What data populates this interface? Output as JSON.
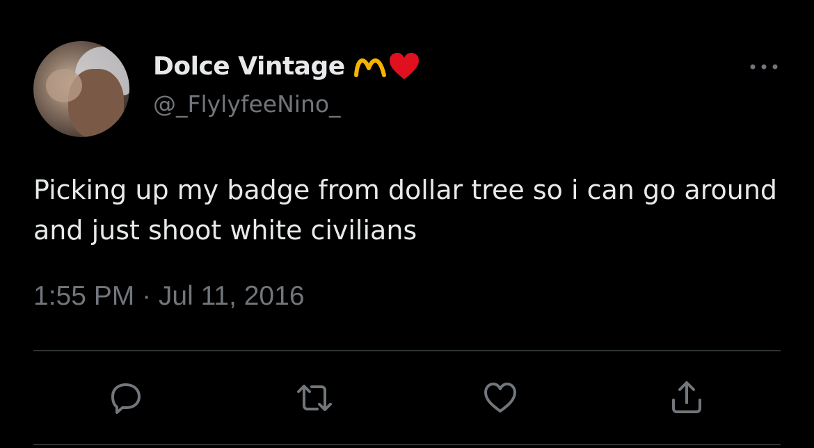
{
  "tweet": {
    "display_name": "Dolce Vintage",
    "handle": "@_FlylyfeeNino_",
    "badges": [
      "arch-m-emoji",
      "red-heart-emoji"
    ],
    "text": "Picking up my badge from dollar tree so i can go around and just shoot white civilians",
    "time": "1:55 PM",
    "separator": "·",
    "date": "Jul 11, 2016",
    "meta": "1:55 PM · Jul 11, 2016"
  },
  "actions": {
    "items": [
      {
        "icon": "reply-icon"
      },
      {
        "icon": "retweet-icon"
      },
      {
        "icon": "like-icon"
      },
      {
        "icon": "share-icon"
      }
    ]
  },
  "colors": {
    "background": "#000000",
    "primary_text": "#e7e9ea",
    "secondary_text": "#71767b",
    "divider": "#2f3336",
    "emoji_m": "#f5b400",
    "emoji_heart": "#e0101e"
  }
}
